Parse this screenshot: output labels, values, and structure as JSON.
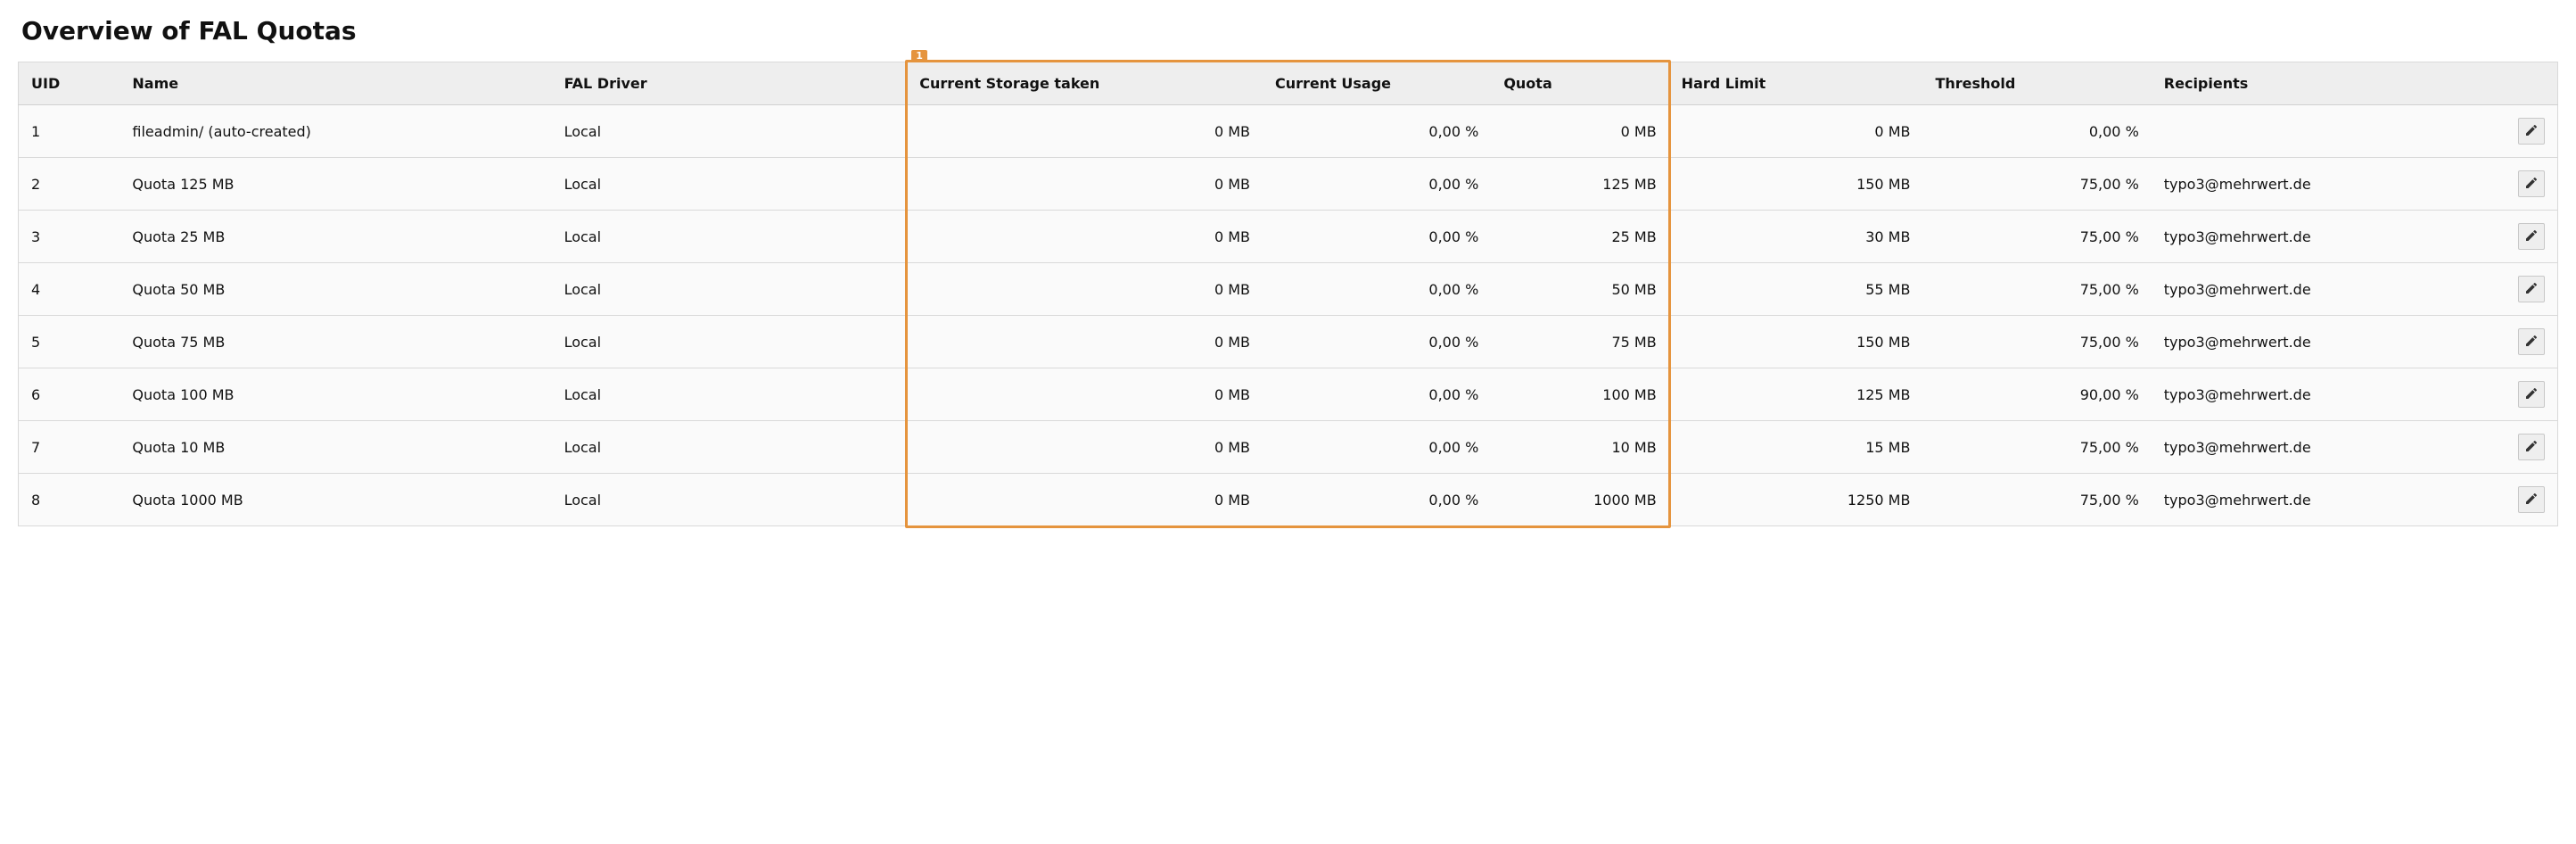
{
  "title": "Overview of FAL Quotas",
  "highlight": {
    "label": "1"
  },
  "table": {
    "headers": {
      "uid": "UID",
      "name": "Name",
      "driver": "FAL Driver",
      "storage": "Current Storage taken",
      "usage": "Current Usage",
      "quota": "Quota",
      "hard": "Hard Limit",
      "threshold": "Threshold",
      "recipients": "Recipients"
    },
    "rows": [
      {
        "uid": "1",
        "name": "fileadmin/ (auto-created)",
        "driver": "Local",
        "storage": "0 MB",
        "usage": "0,00 %",
        "quota": "0 MB",
        "hard": "0 MB",
        "threshold": "0,00 %",
        "recipients": ""
      },
      {
        "uid": "2",
        "name": "Quota 125 MB",
        "driver": "Local",
        "storage": "0 MB",
        "usage": "0,00 %",
        "quota": "125 MB",
        "hard": "150 MB",
        "threshold": "75,00 %",
        "recipients": "typo3@mehrwert.de"
      },
      {
        "uid": "3",
        "name": "Quota 25 MB",
        "driver": "Local",
        "storage": "0 MB",
        "usage": "0,00 %",
        "quota": "25 MB",
        "hard": "30 MB",
        "threshold": "75,00 %",
        "recipients": "typo3@mehrwert.de"
      },
      {
        "uid": "4",
        "name": "Quota 50 MB",
        "driver": "Local",
        "storage": "0 MB",
        "usage": "0,00 %",
        "quota": "50 MB",
        "hard": "55 MB",
        "threshold": "75,00 %",
        "recipients": "typo3@mehrwert.de"
      },
      {
        "uid": "5",
        "name": "Quota 75 MB",
        "driver": "Local",
        "storage": "0 MB",
        "usage": "0,00 %",
        "quota": "75 MB",
        "hard": "150 MB",
        "threshold": "75,00 %",
        "recipients": "typo3@mehrwert.de"
      },
      {
        "uid": "6",
        "name": "Quota 100 MB",
        "driver": "Local",
        "storage": "0 MB",
        "usage": "0,00 %",
        "quota": "100 MB",
        "hard": "125 MB",
        "threshold": "90,00 %",
        "recipients": "typo3@mehrwert.de"
      },
      {
        "uid": "7",
        "name": "Quota 10 MB",
        "driver": "Local",
        "storage": "0 MB",
        "usage": "0,00 %",
        "quota": "10 MB",
        "hard": "15 MB",
        "threshold": "75,00 %",
        "recipients": "typo3@mehrwert.de"
      },
      {
        "uid": "8",
        "name": "Quota 1000 MB",
        "driver": "Local",
        "storage": "0 MB",
        "usage": "0,00 %",
        "quota": "1000 MB",
        "hard": "1250 MB",
        "threshold": "75,00 %",
        "recipients": "typo3@mehrwert.de"
      }
    ]
  }
}
